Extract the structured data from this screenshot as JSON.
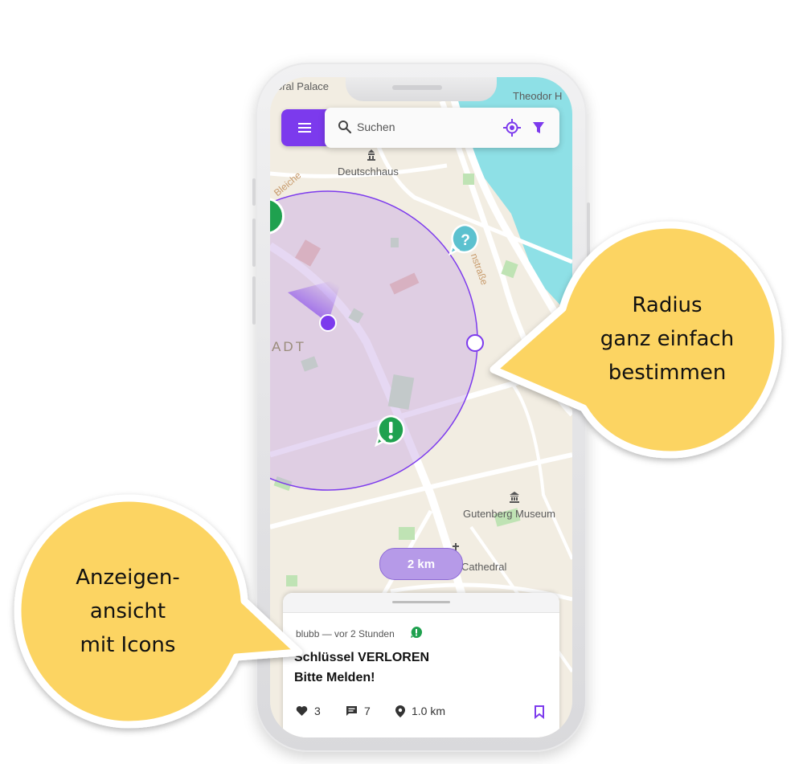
{
  "map": {
    "labels": {
      "palace": "oral Palace",
      "theodor": "Theodor H",
      "deutschhaus": "Deutschhaus",
      "bleiche": "Bleiche",
      "strasse": "nstraße",
      "stadt": "ADT",
      "gutenberg": "Gutenberg Museum",
      "cathedral": "Cathedral"
    }
  },
  "search": {
    "placeholder": "Suchen"
  },
  "radius": {
    "distance_label": "2 km"
  },
  "card": {
    "meta": "blubb — vor 2 Stunden",
    "title_line1": "Schlüssel VERLOREN",
    "title_line2": "Bitte Melden!",
    "likes": "3",
    "comments": "7",
    "distance": "1.0 km"
  },
  "callouts": {
    "right": [
      "Radius",
      "ganz einfach",
      "bestimmen"
    ],
    "left": [
      "Anzeigen-",
      "ansicht",
      "mit Icons"
    ]
  },
  "colors": {
    "accent": "#7c3aed",
    "bubble": "#fcd462",
    "water": "#8ee0e6",
    "alert_green": "#1fa14f",
    "question_teal": "#5cc1cf",
    "map_bg": "#f2ede2"
  },
  "icons": [
    "hamburger-icon",
    "search-icon",
    "locate-icon",
    "filter-icon",
    "alert-marker-icon",
    "question-marker-icon",
    "heart-icon",
    "comment-icon",
    "location-pin-icon",
    "bookmark-icon"
  ]
}
